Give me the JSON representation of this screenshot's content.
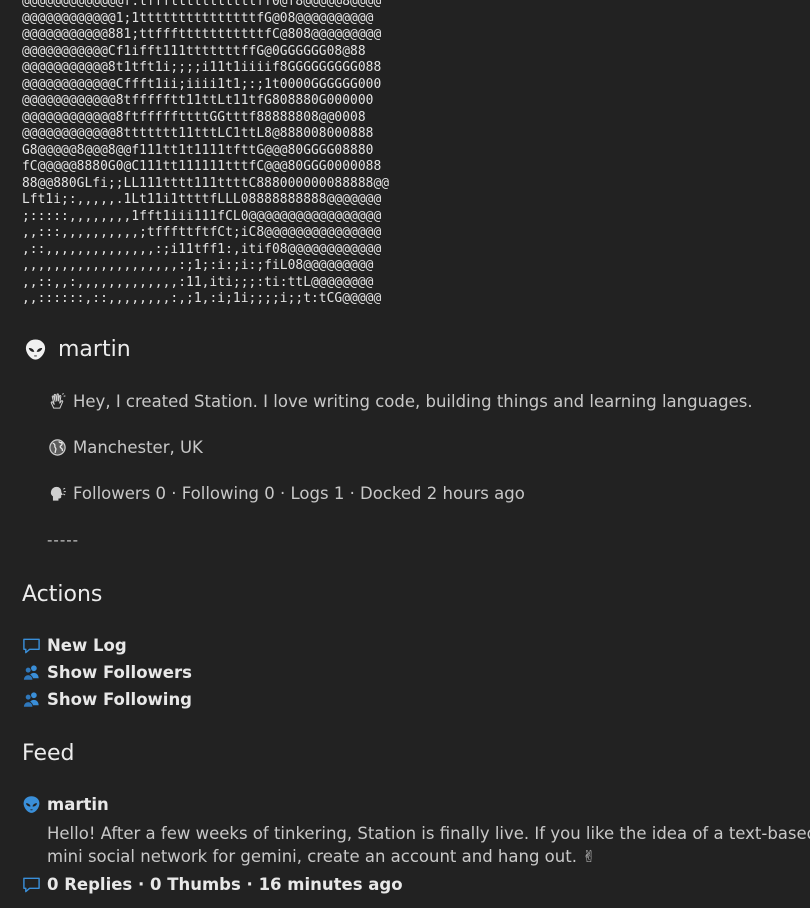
{
  "ascii_art": [
    "@@@@@@@@@@@@@f:tffftttttttttttff0@f8@@@@@8@@@@",
    "@@@@@@@@@@@@1;1tttttttttttttttfG@08@@@@@@@@@@",
    "@@@@@@@@@@@881;ttffftttttttttttfC@808@@@@@@@@@",
    "@@@@@@@@@@@Cf1ifft111tttttttffG@0GGGGGG08@88",
    "@@@@@@@@@@@8t1tft1i;;;;i11t1iiiif8GGGGGGGGG088",
    "@@@@@@@@@@@@Cffft1ii;iiii1t1;:;1t0000GGGGGG000",
    "@@@@@@@@@@@@8tffffftt11ttLt11tfG808880G000000",
    "@@@@@@@@@@@@8ftfffffttttGGtttf88888808@@0008",
    "@@@@@@@@@@@@8ttttttt11tttLC1ttL8@888008000888",
    "G8@@@@@8@@@8@@f111tt1t1111tfttG@@@80GGGG08880",
    "fC@@@@@8880G0@C111tt111111tttfC@@@80GGG0000088",
    "88@@880GLfi;;LL111tttt111ttttC888000000088888@@",
    "Lft1i;:,,,,,.1Lt11i1ttttfLLL08888888888@@@@@@@",
    ";:::::,,,,,,,,1fft1iii111fCL0@@@@@@@@@@@@@@@@@",
    ",,:::,,,,,,,,,,;tfffttftfCt;iC8@@@@@@@@@@@@@@@",
    ",::,,,,,,,,,,,,,,:;i11tff1:,itif08@@@@@@@@@@@@",
    ",,,,,,,,,,,,,,,,,,,,:;1;:i:;i:;fiL08@@@@@@@@@",
    ",,::,,:,,,,,,,,,,,,,:11,iti;;;:ti:ttL@@@@@@@@",
    ",,::::::,::,,,,,,,,:,;1,:i;1i;;;;i;;t:tCG@@@@@"
  ],
  "profile": {
    "icon": "alien-icon",
    "name": "martin",
    "bio_icon": "waving-hand-icon",
    "bio": "Hey, I created Station. I love writing code, building things and learning languages.",
    "location_icon": "globe-icon",
    "location": "Manchester, UK",
    "stats_icon": "speaking-head-icon",
    "stats": "Followers 0 · Following 0 · Logs 1 · Docked 2 hours ago",
    "divider": "-----"
  },
  "actions": {
    "heading": "Actions",
    "items": [
      {
        "icon": "speech-bubble-icon",
        "label": "New Log"
      },
      {
        "icon": "people-icon",
        "label": "Show Followers"
      },
      {
        "icon": "people-icon",
        "label": "Show Following"
      }
    ]
  },
  "feed": {
    "heading": "Feed",
    "post": {
      "author_icon": "alien-icon",
      "author": "martin",
      "body": "Hello! After a few weeks of tinkering, Station is finally live. If you like the idea of a text-based mini social network for gemini, create an account and hang out. ✌",
      "meta_icon": "speech-bubble-icon",
      "meta": "0 Replies · 0 Thumbs · 16 minutes ago"
    }
  },
  "colors": {
    "background": "#222222",
    "text": "#d6d6d6",
    "accent_blue": "#3a8fd9"
  }
}
